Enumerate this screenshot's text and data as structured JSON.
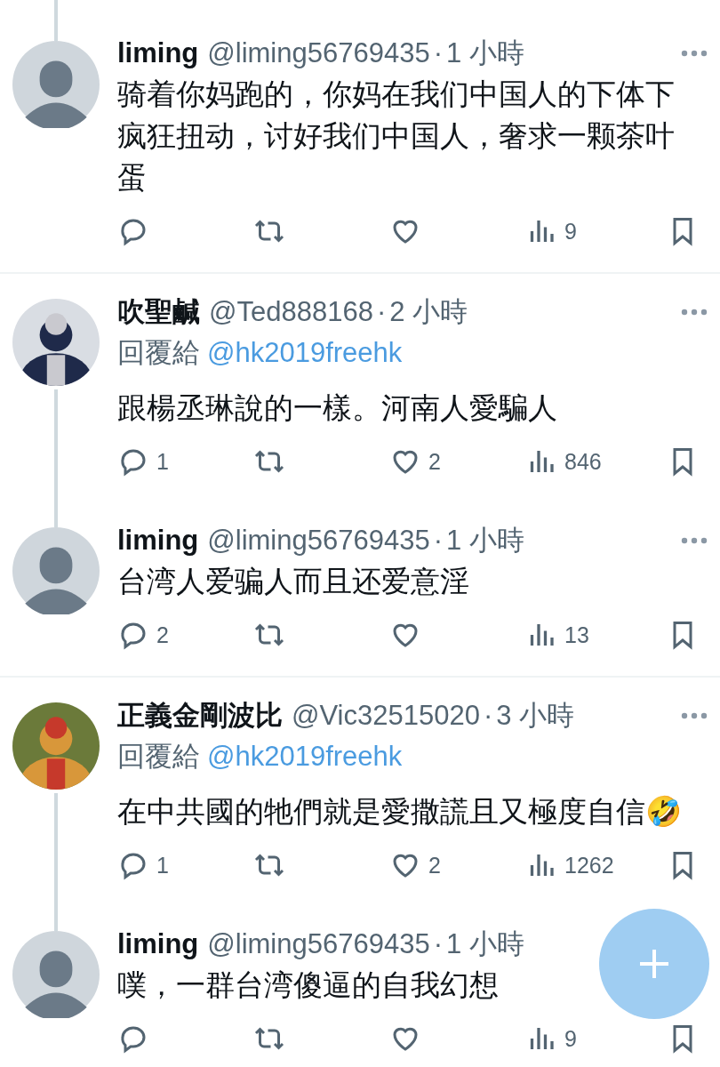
{
  "conversations": [
    {
      "continues_above": true,
      "tweets": [
        {
          "avatar": {
            "kind": "default"
          },
          "name": "liming",
          "handle": "@liming56769435",
          "separator": "·",
          "time": "1 小時",
          "text": "骑着你妈跑的，你妈在我们中国人的下体下疯狂扭动，讨好我们中国人，奢求一颗茶叶蛋",
          "stats": {
            "views": "9"
          }
        }
      ]
    },
    {
      "continues_above": false,
      "tweets": [
        {
          "name": "吹聖鹹",
          "handle": "@Ted888168",
          "separator": "·",
          "time": "2 小時",
          "reply_label": "回覆給",
          "reply_to": "@hk2019freehk",
          "text": "跟楊丞琳說的一樣。河南人愛騙人",
          "stats": {
            "replies": "1",
            "likes": "2",
            "views": "846"
          }
        },
        {
          "avatar": {
            "kind": "default"
          },
          "name": "liming",
          "handle": "@liming56769435",
          "separator": "·",
          "time": "1 小時",
          "text": "台湾人爱骗人而且还爱意淫",
          "stats": {
            "replies": "2",
            "views": "13"
          }
        }
      ]
    },
    {
      "continues_above": false,
      "tweets": [
        {
          "name": "正義金剛波比",
          "handle": "@Vic32515020",
          "separator": "·",
          "time": "3 小時",
          "reply_label": "回覆給",
          "reply_to": "@hk2019freehk",
          "text": "在中共國的牠們就是愛撒謊且又極度自信🤣",
          "stats": {
            "replies": "1",
            "likes": "2",
            "views": "1262"
          }
        },
        {
          "avatar": {
            "kind": "default"
          },
          "name": "liming",
          "handle": "@liming56769435",
          "separator": "·",
          "time": "1 小時",
          "text": "噗，一群台湾傻逼的自我幻想",
          "stats": {
            "views": "9"
          }
        }
      ]
    }
  ]
}
